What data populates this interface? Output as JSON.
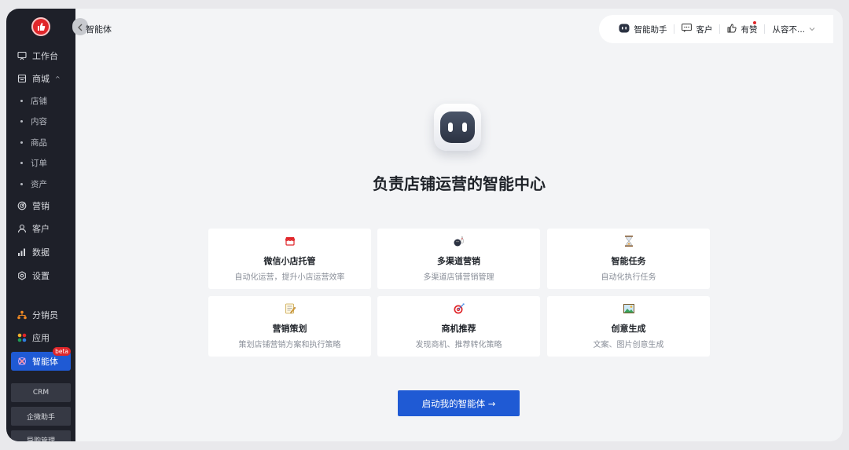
{
  "header": {
    "breadcrumb": "智能体",
    "toolbar": {
      "assistant_label": "智能助手",
      "customer_label": "客户",
      "like_label": "有赞",
      "account_label": "从容不..."
    }
  },
  "sidebar": {
    "items": [
      {
        "label": "工作台",
        "icon": "workbench-icon"
      },
      {
        "label": "商城",
        "icon": "store-icon",
        "expanded": true
      },
      {
        "label": "营销",
        "icon": "target-icon"
      },
      {
        "label": "客户",
        "icon": "user-icon"
      },
      {
        "label": "数据",
        "icon": "bar-chart-icon"
      },
      {
        "label": "设置",
        "icon": "gear-icon"
      },
      {
        "label": "分销员",
        "icon": "hierarchy-icon"
      },
      {
        "label": "应用",
        "icon": "apps-icon"
      },
      {
        "label": "智能体",
        "icon": "agent-icon",
        "badge": "beta",
        "active": true
      }
    ],
    "sub_items": [
      "店铺",
      "内容",
      "商品",
      "订单",
      "资产"
    ],
    "tools": [
      "CRM",
      "企微助手",
      "导购管理"
    ]
  },
  "main": {
    "headline": "负责店铺运营的智能中心",
    "cards": [
      {
        "title": "微信小店托管",
        "desc": "自动化运营，提升小店运营效率",
        "icon": "shop-awning-icon"
      },
      {
        "title": "多渠道营销",
        "desc": "多渠道店铺营销管理",
        "icon": "bowling-icon"
      },
      {
        "title": "智能任务",
        "desc": "自动化执行任务",
        "icon": "hourglass-icon"
      },
      {
        "title": "营销策划",
        "desc": "策划店铺营销方案和执行策略",
        "icon": "memo-icon"
      },
      {
        "title": "商机推荐",
        "desc": "发现商机、推荐转化策略",
        "icon": "dart-target-icon"
      },
      {
        "title": "创意生成",
        "desc": "文案、图片创意生成",
        "icon": "picture-icon"
      }
    ],
    "start_button": "启动我的智能体 →"
  },
  "colors": {
    "sidebar_bg": "#1e2029",
    "accent": "#1f5ad4",
    "brand_red": "#e0262a"
  }
}
